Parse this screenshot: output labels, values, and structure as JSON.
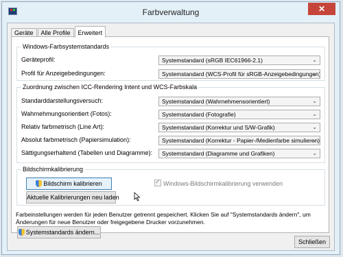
{
  "window": {
    "title": "Farbverwaltung",
    "close_label": "✕"
  },
  "tabs": [
    {
      "label": "Geräte"
    },
    {
      "label": "Alle Profile"
    },
    {
      "label": "Erweitert"
    }
  ],
  "windows_standards": {
    "title": "Windows-Farbsystemstandards",
    "rows": [
      {
        "label": "Geräteprofil:",
        "value": "Systemstandard (sRGB IEC61966-2.1)"
      },
      {
        "label": "Profil für Anzeigebedingungen:",
        "value": "Systemstandard (WCS-Profil für sRGB-Anzeigebedingungen)"
      }
    ]
  },
  "icc_mapping": {
    "title": "Zuordnung zwischen ICC-Rendering Intent und WCS-Farbskala",
    "rows": [
      {
        "label": "Standarddarstellungsversuch:",
        "value": "Systemstandard (Wahrnehmensorientiert)"
      },
      {
        "label": "Wahrnehmungsorientiert (Fotos):",
        "value": "Systemstandard (Fotografie)"
      },
      {
        "label": "Relativ farbmetrisch (Line Art):",
        "value": "Systemstandard (Korrektur und S/W-Grafik)"
      },
      {
        "label": "Absolut farbmetrisch (Papiersimulation):",
        "value": "Systemstandard (Korrektur - Papier-/Medienfarbe simulieren)"
      },
      {
        "label": "Sättigungserhaltend (Tabellen und Diagramme):",
        "value": "Systemstandard (Diagramme und Grafiken)"
      }
    ]
  },
  "calibration": {
    "title": "Bildschirmkalibrierung",
    "calibrate_button": "Bildschirm kalibrieren",
    "reload_button": "Aktuelle Kalibrierungen neu laden",
    "use_windows_calibration": "Windows-Bildschirmkalibrierung verwenden"
  },
  "info_text": "Farbeinstellungen werden für jeden Benutzer getrennt gespeichert. Klicken Sie auf \"Systemstandards ändern\", um Änderungen für neue Benutzer oder freigegebene Drucker vorzunehmen.",
  "change_defaults_button": "Systemstandards ändern...",
  "close_button": "Schließen",
  "combo_arrow": "⌄"
}
